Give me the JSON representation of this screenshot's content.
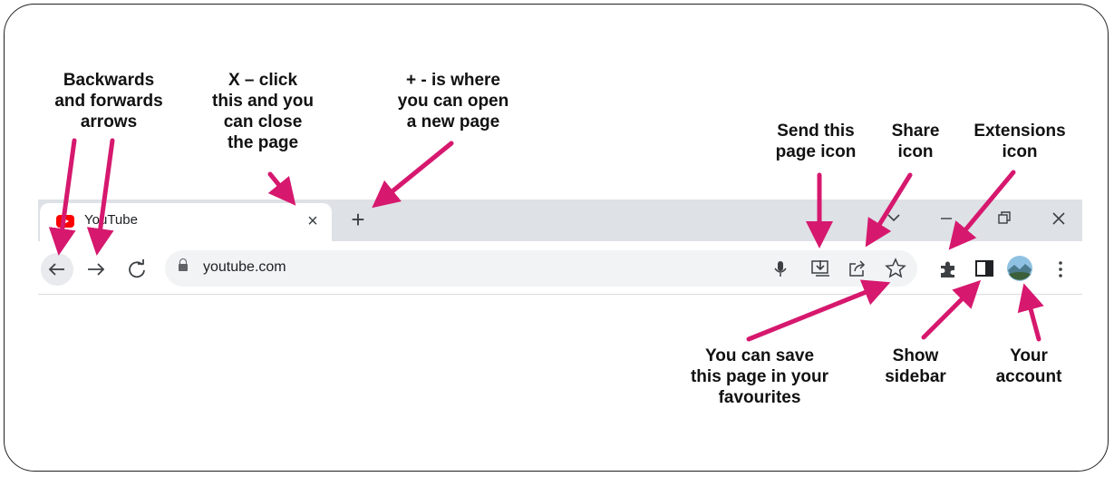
{
  "callouts": {
    "back_forward": "Backwards\nand forwards\narrows",
    "close_tab": "X – click\nthis and you\ncan close\nthe page",
    "new_tab": "+ - is where\nyou can open\na new page",
    "send_page": "Send this\npage icon",
    "share": "Share\nicon",
    "extensions": "Extensions\nicon",
    "favourites": "You can save\nthis page in your\nfavourites",
    "sidebar": "Show\nsidebar",
    "account": "Your\naccount"
  },
  "browser": {
    "tab_title": "YouTube",
    "tab_close_glyph": "×",
    "new_tab_glyph": "+",
    "url": "youtube.com"
  },
  "icons": {
    "back": "back-arrow-icon",
    "forward": "forward-arrow-icon",
    "reload": "reload-icon",
    "mic": "microphone-icon",
    "send": "send-to-device-icon",
    "share": "share-icon",
    "star": "star-icon",
    "extensions": "puzzle-icon",
    "sidebar": "sidebar-icon",
    "menu": "kebab-menu-icon"
  },
  "colors": {
    "arrow": "#d6186e",
    "tabbar": "#dee1e6",
    "omnibox": "#f1f3f4",
    "youtube_red": "#ff0000"
  }
}
